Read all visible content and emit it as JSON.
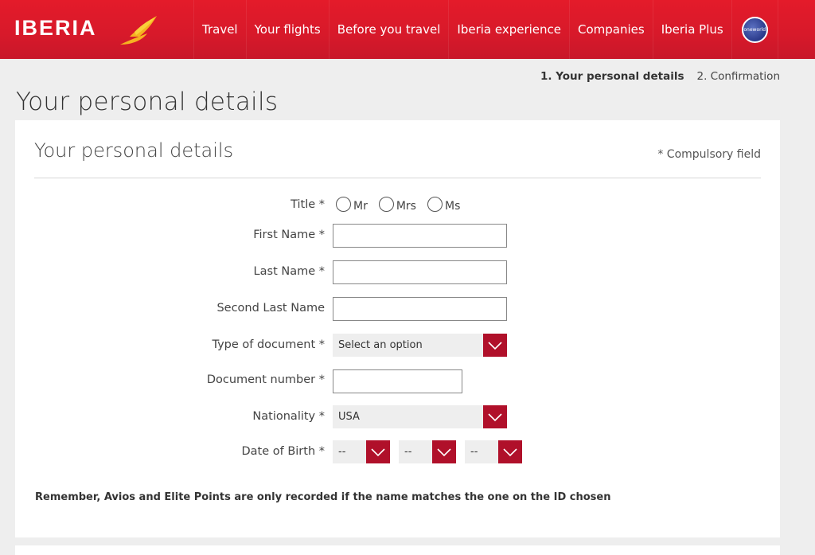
{
  "header": {
    "logo_text": "IBERIA",
    "brand_color": "#d7192a",
    "nav": [
      "Travel",
      "Your flights",
      "Before you travel",
      "Iberia experience",
      "Companies",
      "Iberia Plus"
    ],
    "oneworld_label": "oneworld"
  },
  "steps": {
    "active": "1.  Your personal details",
    "next": "2.  Confirmation"
  },
  "page_title": "Your personal details",
  "form": {
    "title": "Your personal details",
    "required_note": "* Compulsory field",
    "title_label": "Title *",
    "title_options": [
      "Mr",
      "Mrs",
      "Ms"
    ],
    "first_name_label": "First Name *",
    "first_name_value": "",
    "last_name_label": "Last Name *",
    "last_name_value": "",
    "second_last_name_label": "Second Last Name",
    "second_last_name_value": "",
    "document_type_label": "Type of document *",
    "document_type_value": "Select an option",
    "document_number_label": "Document number *",
    "document_number_value": "",
    "nationality_label": "Nationality *",
    "nationality_value": "USA",
    "dob_label": "Date of Birth *",
    "dob_day": "--",
    "dob_month": "--",
    "dob_year": "--",
    "note": "Remember, Avios and Elite Points are only recorded if the name matches the one on the ID chosen",
    "accent_color": "#b0102a"
  }
}
